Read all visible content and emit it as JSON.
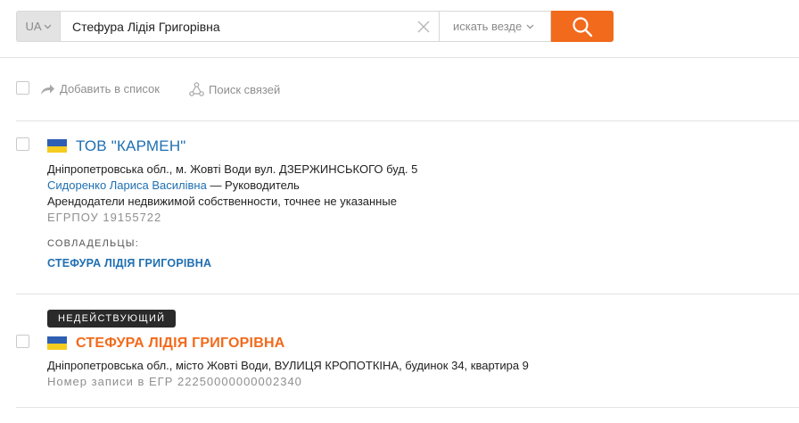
{
  "search": {
    "country": "UA",
    "query": "Стефура Лідія Григорівна",
    "scope": "искать везде"
  },
  "toolbar": {
    "add_to_list": "Добавить в список",
    "find_links": "Поиск связей"
  },
  "results": [
    {
      "title": "ТОВ \"КАРМЕН\"",
      "address": "Дніпропетровська обл., м. Жовті Води вул. ДЗЕРЖИНСЬКОГО буд. 5",
      "head_name": "Сидоренко Лариса Василівна",
      "head_role": " — Руководитель",
      "activity": "Арендодатели недвижимой собственности, точнее не указанные",
      "code": "ЕГРПОУ 19155722",
      "owners_label": "СОВЛАДЕЛЬЦЫ:",
      "owner": "СТЕФУРА ЛІДІЯ ГРИГОРІВНА"
    },
    {
      "status": "НЕДЕЙСТВУЮЩИЙ",
      "title": "СТЕФУРА ЛІДІЯ ГРИГОРІВНА",
      "address": "Дніпропетровська обл., місто Жовті Води, ВУЛИЦЯ КРОПОТКІНА, будинок 34, квартира 9",
      "record": "Номер записи в ЕГР 22250000000002340"
    }
  ],
  "colors": {
    "accent": "#f26a1b",
    "link": "#1f6fb2",
    "flag_blue": "#2f5fb3",
    "flag_yellow": "#f5cc1f"
  }
}
